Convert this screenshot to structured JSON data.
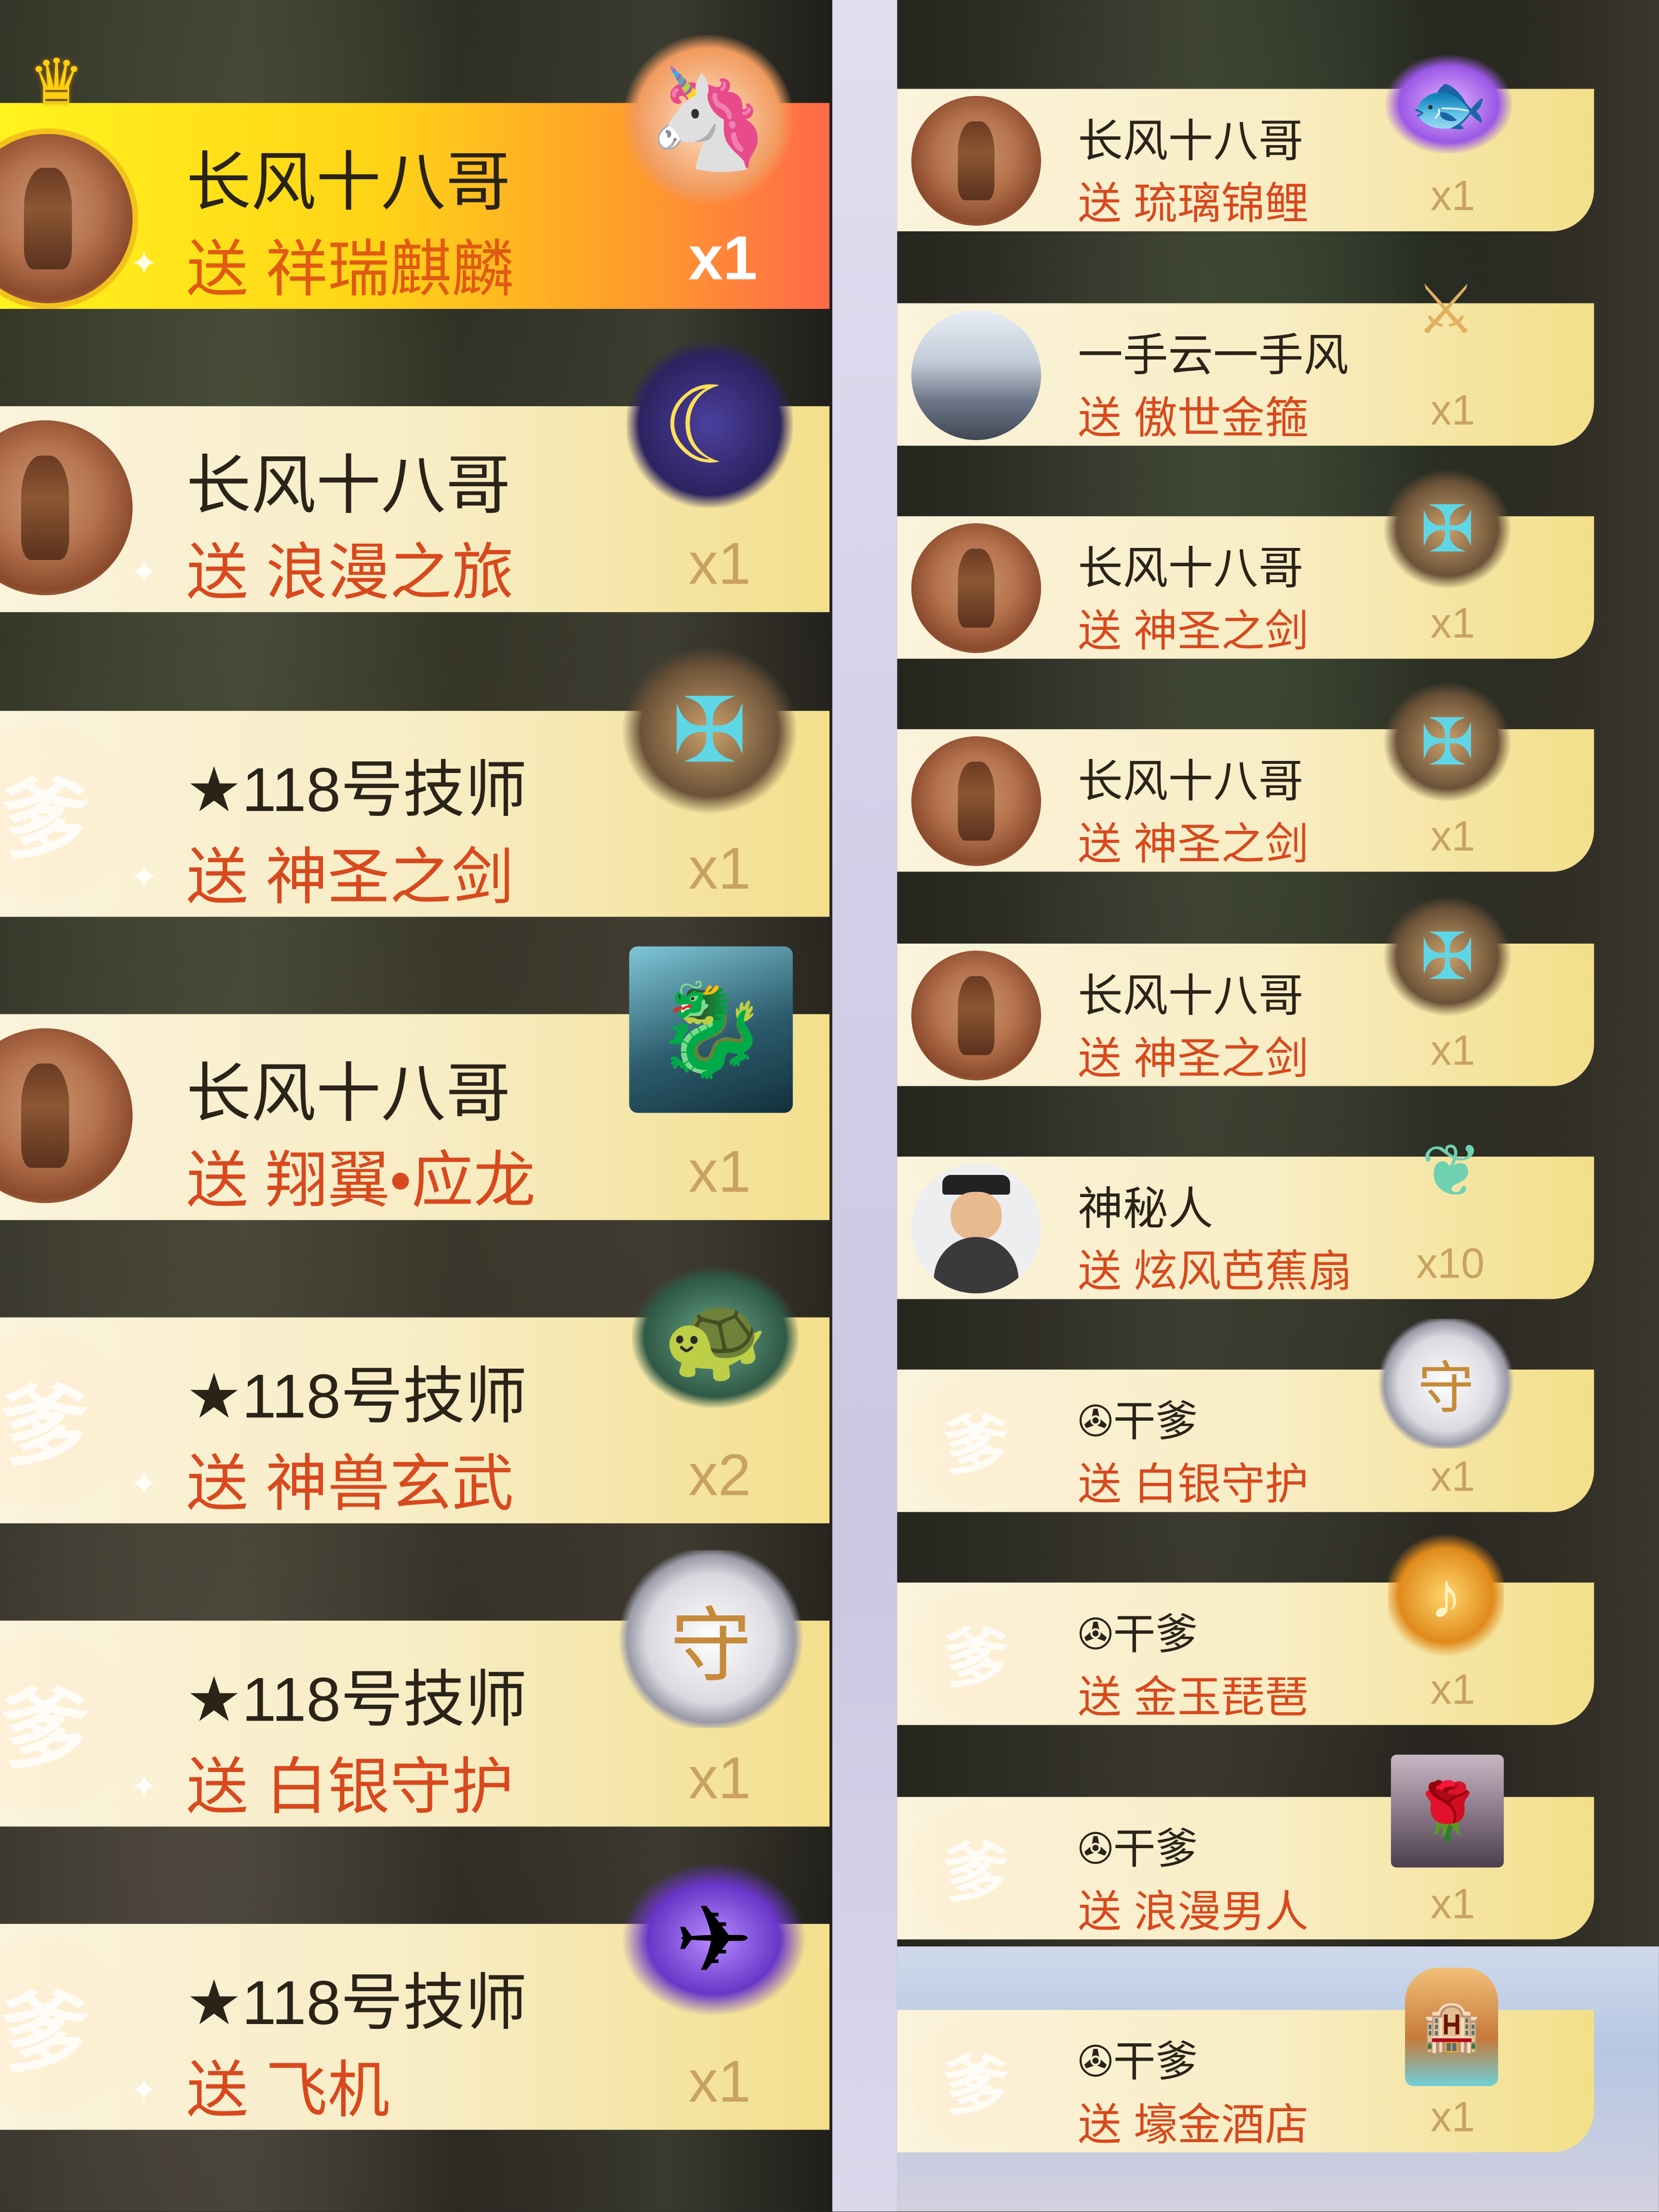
{
  "left_feed": [
    {
      "name": "长风十八哥",
      "gift": "送 祥瑞麒麟",
      "qty": "x1",
      "avatar": "photo",
      "vip": true,
      "gift_icon": "qilin-icon"
    },
    {
      "name": "长风十八哥",
      "gift": "送 浪漫之旅",
      "qty": "x1",
      "avatar": "photo",
      "vip": false,
      "gift_icon": "moon-icon"
    },
    {
      "name": "★118号技师",
      "gift": "送 神圣之剑",
      "qty": "x1",
      "avatar": "ghost",
      "vip": false,
      "gift_icon": "sword-icon"
    },
    {
      "name": "长风十八哥",
      "gift": "送 翔翼•应龙",
      "qty": "x1",
      "avatar": "photo",
      "vip": false,
      "gift_icon": "dragon-icon"
    },
    {
      "name": "★118号技师",
      "gift": "送 神兽玄武",
      "qty": "x2",
      "avatar": "ghost",
      "vip": false,
      "gift_icon": "turtle-icon"
    },
    {
      "name": "★118号技师",
      "gift": "送 白银守护",
      "qty": "x1",
      "avatar": "ghost",
      "vip": false,
      "gift_icon": "shield-icon"
    },
    {
      "name": "★118号技师",
      "gift": "送 飞机",
      "qty": "x1",
      "avatar": "ghost",
      "vip": false,
      "gift_icon": "plane-icon"
    }
  ],
  "right_feed": [
    {
      "name": "长风十八哥",
      "gift": "送 琉璃锦鲤",
      "qty": "x1",
      "avatar": "photo",
      "gift_icon": "koi-icon"
    },
    {
      "name": "一手云一手风",
      "gift": "送 傲世金箍",
      "qty": "x1",
      "avatar": "castle",
      "gift_icon": "staff-icon"
    },
    {
      "name": "长风十八哥",
      "gift": "送 神圣之剑",
      "qty": "x1",
      "avatar": "photo",
      "gift_icon": "sword-icon"
    },
    {
      "name": "长风十八哥",
      "gift": "送 神圣之剑",
      "qty": "x1",
      "avatar": "photo",
      "gift_icon": "sword-icon"
    },
    {
      "name": "长风十八哥",
      "gift": "送 神圣之剑",
      "qty": "x1",
      "avatar": "photo",
      "gift_icon": "sword-icon"
    },
    {
      "name": "神秘人",
      "gift": "送 炫风芭蕉扇",
      "qty": "x10",
      "avatar": "mystery",
      "gift_icon": "fan-icon"
    },
    {
      "name": "✇干爹",
      "gift": "送 白银守护",
      "qty": "x1",
      "avatar": "ghost",
      "gift_icon": "shield-icon"
    },
    {
      "name": "✇干爹",
      "gift": "送 金玉琵琶",
      "qty": "x1",
      "avatar": "ghost",
      "gift_icon": "pipa-icon"
    },
    {
      "name": "✇干爹",
      "gift": "送 浪漫男人",
      "qty": "x1",
      "avatar": "ghost",
      "gift_icon": "man-icon"
    },
    {
      "name": "✇干爹",
      "gift": "送 壕金酒店",
      "qty": "x1",
      "avatar": "ghost",
      "gift_icon": "hotel-icon"
    }
  ],
  "ghost_glyph": "爹",
  "colors": {
    "gift_text": "#d8491d",
    "name_text": "#2a2318",
    "qty_text": "#c9a262",
    "vip_start": "#fff31e",
    "vip_end": "#ff6a4a"
  }
}
